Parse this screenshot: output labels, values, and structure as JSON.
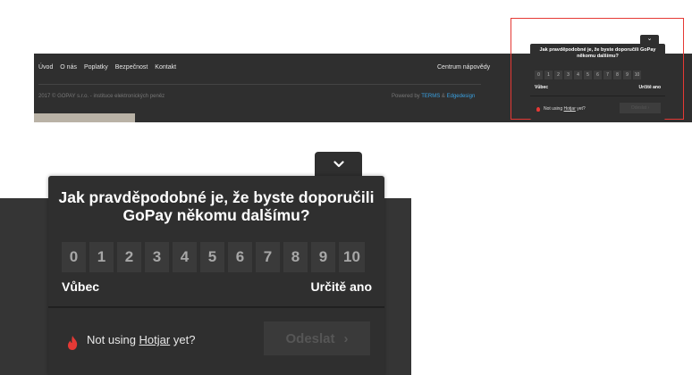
{
  "footer": {
    "nav": [
      "Úvod",
      "O nás",
      "Poplatky",
      "Bezpečnost",
      "Kontakt"
    ],
    "help_link": "Centrum nápovědy",
    "copyright": "2017 © GOPAY s.r.o. - instituce elektronických peněz",
    "powered_prefix": "Powered by",
    "powered_link1": "TERMS",
    "powered_amp": "&",
    "powered_link2": "Edgedesign"
  },
  "survey": {
    "question": "Jak pravděpodobné je, že byste doporučili GoPay někomu dalšímu?",
    "scale": [
      "0",
      "1",
      "2",
      "3",
      "4",
      "5",
      "6",
      "7",
      "8",
      "9",
      "10"
    ],
    "low_label": "Vůbec",
    "high_label": "Určitě ano",
    "hotjar_prefix": "Not using",
    "hotjar_link": "Hotjar",
    "hotjar_suffix": "yet?",
    "send_label": "Odeslat",
    "send_arrow": "›",
    "toggle_icon": "chevron-down-icon",
    "flame_icon": "hotjar-flame-icon"
  },
  "colors": {
    "widget_bg": "#2f2f2f",
    "button_bg": "#3a3a3a",
    "highlight_border": "#e53935",
    "flame": "#e53935",
    "link": "#3aa0e0"
  }
}
